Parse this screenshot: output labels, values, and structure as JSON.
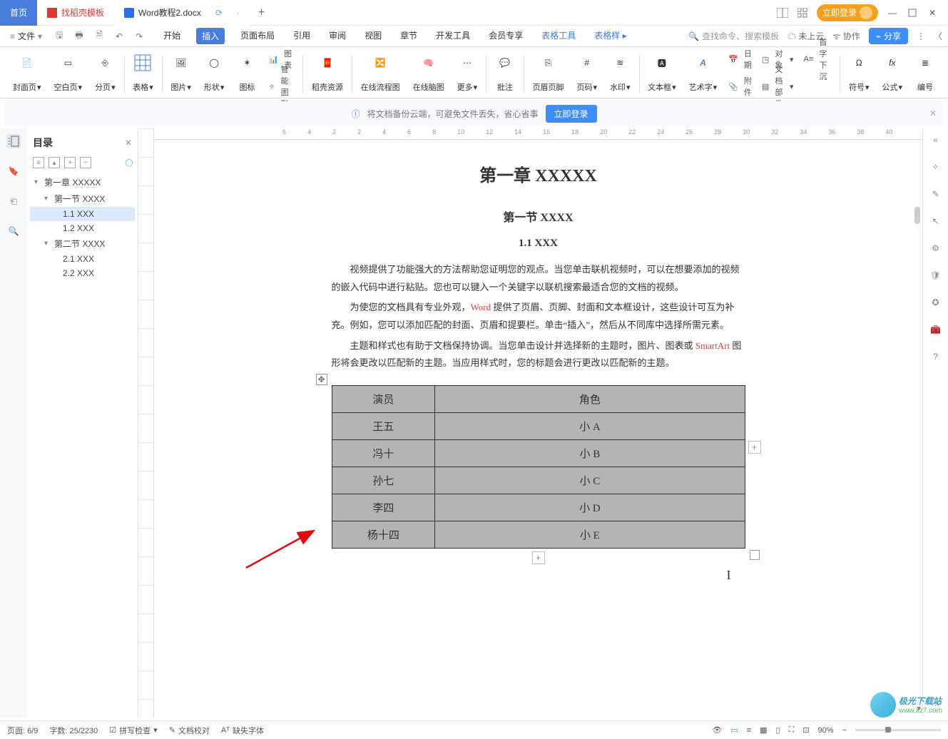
{
  "tabs": {
    "home": "首页",
    "template": "找稻壳模板",
    "doc": "Word教程2.docx"
  },
  "login_pill": "立即登录",
  "file": "文件",
  "menus": {
    "start": "开始",
    "insert": "插入",
    "layout": "页面布局",
    "ref": "引用",
    "review": "审阅",
    "view": "视图",
    "chapter": "章节",
    "dev": "开发工具",
    "vip": "会员专享",
    "ttools": "表格工具",
    "tstyle": "表格样"
  },
  "search_ph": "查找命令、搜索模板",
  "cloud": "未上云",
  "collab": "协作",
  "share": "分享",
  "ribbon": {
    "cover": "封面页",
    "blank": "空白页",
    "break": "分页",
    "table": "表格",
    "pic": "图片",
    "shape": "形状",
    "icon": "图标",
    "chart": "图表",
    "smartart": "智能图形",
    "daoke": "稻壳资源",
    "flow": "在线流程图",
    "mind": "在线脑图",
    "more": "更多",
    "comment": "批注",
    "hf": "页眉页脚",
    "pagenum": "页码",
    "watermark": "水印",
    "textbox": "文本框",
    "wordart": "艺术字",
    "date": "日期",
    "obj": "对象",
    "attach": "附件",
    "docparts": "文档部件",
    "cap": "首字下沉",
    "symbol": "符号",
    "formula": "公式",
    "number": "编号"
  },
  "banner": {
    "text": "将文档备份云端，可避免文件丢失，省心省事",
    "btn": "立即登录"
  },
  "nav": {
    "title": "目录",
    "t1": "第一章 XXXXX",
    "t1_1": "第一节 XXXX",
    "t1_1_1": "1.1 XXX",
    "t1_1_2": "1.2 XXX",
    "t1_2": "第二节 XXXX",
    "t1_2_1": "2.1 XXX",
    "t1_2_2": "2.2 XXX"
  },
  "ruler": [
    "6",
    "4",
    "2",
    "2",
    "4",
    "6",
    "8",
    "10",
    "12",
    "14",
    "16",
    "18",
    "20",
    "22",
    "24",
    "26",
    "28",
    "30",
    "32",
    "34",
    "36",
    "38",
    "40"
  ],
  "doc": {
    "h1": "第一章 XXXXX",
    "h2": "第一节 XXXX",
    "h3": "1.1 XXX",
    "p1a": "视频提供了功能强大的方法帮助您证明您的观点。当您单击联机视频时，可以在想要添加的视频的嵌入代码中进行粘贴。您也可以键入一个关键字以联机搜索最适合您的文档的视频。",
    "p2a": "为使您的文档具有专业外观，",
    "p2r": "Word",
    "p2b": " 提供了页眉、页脚、封面和文本框设计，这些设计可互为补充。例如，您可以添加匹配的封面、页眉和提要栏。单击“插入”，然后从不同库中选择所需元素。",
    "p3a": "主题和样式也有助于文档保持协调。当您单击设计并选择新的主题时，图片、图表或 ",
    "p3r": "SmartArt",
    "p3b": " 图形将会更改以匹配新的主题。当应用样式时，您的标题会进行更改以匹配新的主题。",
    "table": {
      "header": [
        "演员",
        "角色"
      ],
      "rows": [
        [
          "王五",
          "小 A"
        ],
        [
          "冯十",
          "小 B"
        ],
        [
          "孙七",
          "小 C"
        ],
        [
          "李四",
          "小 D"
        ],
        [
          "杨十四",
          "小 E"
        ]
      ]
    }
  },
  "status": {
    "page": "页面: 6/9",
    "words": "字数: 25/2230",
    "spell": "拼写检查",
    "proof": "文档校对",
    "font": "缺失字体",
    "zoom": "90%"
  },
  "watermark": {
    "a": "极光下载站",
    "b": "www.xz7.com"
  }
}
